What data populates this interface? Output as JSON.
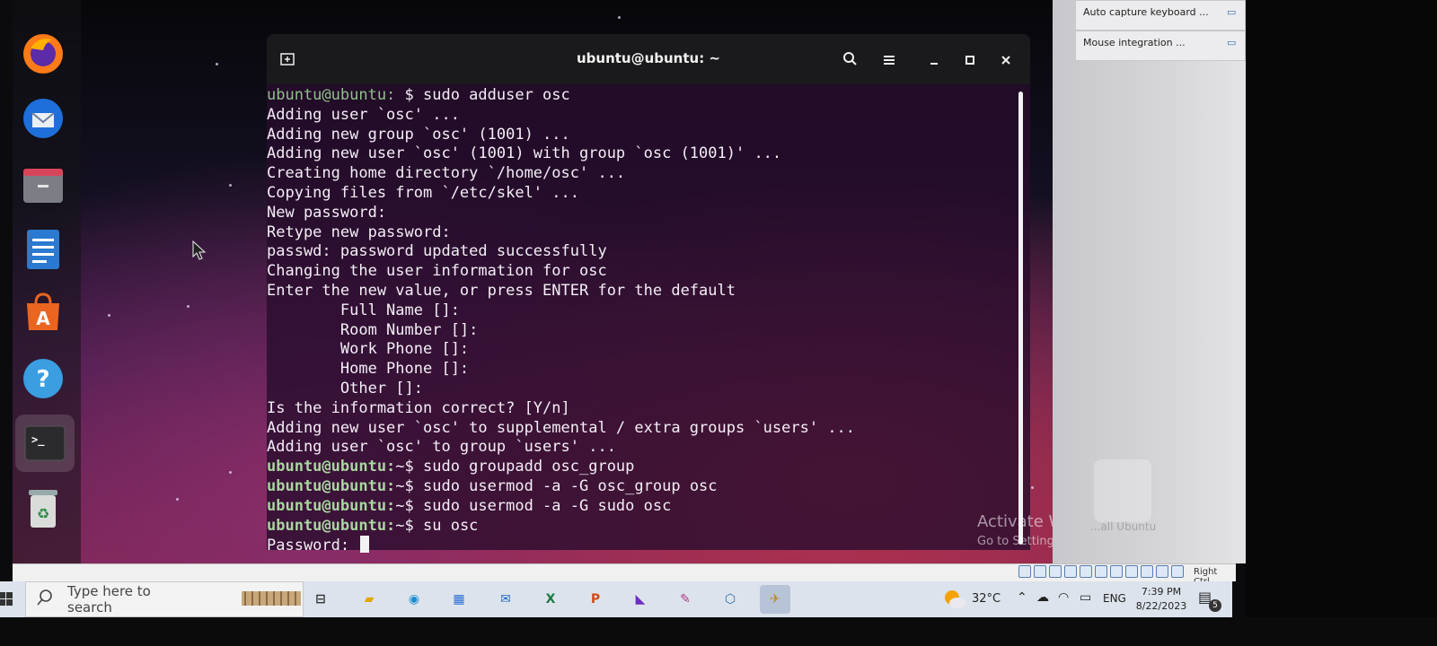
{
  "terminal": {
    "title": "ubuntu@ubuntu: ~",
    "lines": [
      {
        "prompt": "ubuntu@ubuntu:",
        "cmd": " $ sudo adduser osc",
        "dim": true
      },
      {
        "text": "Adding user `osc' ..."
      },
      {
        "text": "Adding new group `osc' (1001) ..."
      },
      {
        "text": "Adding new user `osc' (1001) with group `osc (1001)' ..."
      },
      {
        "text": "Creating home directory `/home/osc' ..."
      },
      {
        "text": "Copying files from `/etc/skel' ..."
      },
      {
        "text": "New password:"
      },
      {
        "text": "Retype new password:"
      },
      {
        "text": "passwd: password updated successfully"
      },
      {
        "text": "Changing the user information for osc"
      },
      {
        "text": "Enter the new value, or press ENTER for the default"
      },
      {
        "text": "        Full Name []:"
      },
      {
        "text": "        Room Number []:"
      },
      {
        "text": "        Work Phone []:"
      },
      {
        "text": "        Home Phone []:"
      },
      {
        "text": "        Other []:"
      },
      {
        "text": "Is the information correct? [Y/n]"
      },
      {
        "text": "Adding new user `osc' to supplemental / extra groups `users' ..."
      },
      {
        "text": "Adding user `osc' to group `users' ..."
      },
      {
        "prompt": "ubuntu@ubuntu:",
        "cmd": "~$ sudo groupadd osc_group"
      },
      {
        "prompt": "ubuntu@ubuntu:",
        "cmd": "~$ sudo usermod -a -G osc_group osc"
      },
      {
        "prompt": "ubuntu@ubuntu:",
        "cmd": "~$ sudo usermod -a -G sudo osc"
      },
      {
        "prompt": "ubuntu@ubuntu:",
        "cmd": "~$ su osc"
      }
    ],
    "password_prompt": "Password: "
  },
  "activate": {
    "line1": "Activate W",
    "line2": "Go to Setting"
  },
  "vbox_notifications": [
    {
      "label": "Auto capture keyboard ..."
    },
    {
      "label": "Mouse integration ..."
    }
  ],
  "vbox_ghost_text": "...all Ubuntu",
  "vbox_status": {
    "host_key": "Right Ctrl"
  },
  "taskbar": {
    "search_placeholder": "Type here to search",
    "weather": "32°C",
    "language": "ENG",
    "time": "7:39 PM",
    "date": "8/22/2023",
    "notification_count": "5"
  },
  "colors": {
    "prompt_green": "#a9d6a0",
    "terminal_header": "#1a1a1c",
    "taskbar": "#dde3ec"
  }
}
